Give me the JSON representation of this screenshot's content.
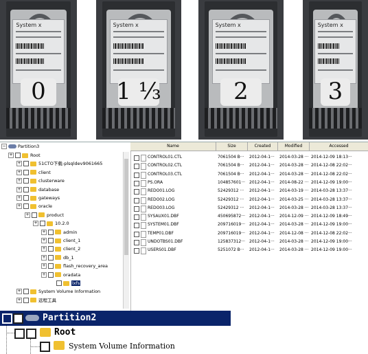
{
  "photos": [
    {
      "handwritten": "0",
      "label_header": "System x"
    },
    {
      "handwritten": "1 ⅓",
      "label_header": "System x"
    },
    {
      "handwritten": "2",
      "label_header": "System x"
    },
    {
      "handwritten": "3",
      "label_header": "System x"
    }
  ],
  "tree": {
    "partition_label": "Partition3",
    "nodes": [
      {
        "label": "Root",
        "level": 0
      },
      {
        "label": "51CTO下载-plsqldev9061665",
        "level": 1
      },
      {
        "label": "client",
        "level": 1
      },
      {
        "label": "clusterware",
        "level": 1
      },
      {
        "label": "database",
        "level": 1
      },
      {
        "label": "gateways",
        "level": 1
      },
      {
        "label": "oracle",
        "level": 1
      },
      {
        "label": "product",
        "level": 2
      },
      {
        "label": "10.2.0",
        "level": 3
      },
      {
        "label": "admin",
        "level": 4
      },
      {
        "label": "client_1",
        "level": 4
      },
      {
        "label": "client_2",
        "level": 4
      },
      {
        "label": "db_1",
        "level": 4
      },
      {
        "label": "flash_recovery_area",
        "level": 4
      },
      {
        "label": "oradata",
        "level": 4
      },
      {
        "label": "lxfs",
        "level": 5,
        "selected": true
      },
      {
        "label": "System Volume Information",
        "level": 1
      },
      {
        "label": "远程工具",
        "level": 1
      }
    ]
  },
  "files": {
    "columns": [
      "Name",
      "Size",
      "Created",
      "Modified",
      "Accessed"
    ],
    "rows": [
      {
        "name": "CONTROL01.CTL",
        "size": "7061504 B···",
        "created": "2012-04-1···",
        "modified": "2014-03-28 ···",
        "accessed": "2014-12-09 18:13···"
      },
      {
        "name": "CONTROL02.CTL",
        "size": "7061504 B···",
        "created": "2012-04-1···",
        "modified": "2014-03-28 ···",
        "accessed": "2014-12-08 22:02···"
      },
      {
        "name": "CONTROL03.CTL",
        "size": "7061504 B···",
        "created": "2012-04-1···",
        "modified": "2014-03-28 ···",
        "accessed": "2014-12-08 22:02···"
      },
      {
        "name": "PS.ORA",
        "size": "104857601···",
        "created": "2012-04-1···",
        "modified": "2014-08-22 ···",
        "accessed": "2014-12-09 19:00···"
      },
      {
        "name": "REDO01.LOG",
        "size": "52429312 ···",
        "created": "2012-04-1···",
        "modified": "2014-03-19 ···",
        "accessed": "2014-03-28 13:37···"
      },
      {
        "name": "REDO02.LOG",
        "size": "52429312 ···",
        "created": "2012-04-1···",
        "modified": "2014-03-25 ···",
        "accessed": "2014-03-28 13:37···"
      },
      {
        "name": "REDO03.LOG",
        "size": "52429312 ···",
        "created": "2012-04-1···",
        "modified": "2014-03-28 ···",
        "accessed": "2014-03-28 13:37···"
      },
      {
        "name": "SYSAUX01.DBF",
        "size": "450695872···",
        "created": "2012-04-1···",
        "modified": "2014-12-09 ···",
        "accessed": "2014-12-09 18:49···"
      },
      {
        "name": "SYSTEM01.DBF",
        "size": "209716019···",
        "created": "2012-04-1···",
        "modified": "2014-03-28 ···",
        "accessed": "2014-12-09 19:00···"
      },
      {
        "name": "TEMP01.DBF",
        "size": "209716019···",
        "created": "2012-04-1···",
        "modified": "2014-12-08 ···",
        "accessed": "2014-12-08 22:02···"
      },
      {
        "name": "UNDOTBS01.DBF",
        "size": "125837312···",
        "created": "2012-04-1···",
        "modified": "2014-03-28 ···",
        "accessed": "2014-12-09 19:00···"
      },
      {
        "name": "USERS01.DBF",
        "size": "5251072 B···",
        "created": "2012-04-1···",
        "modified": "2014-03-28 ···",
        "accessed": "2014-12-09 19:00···"
      }
    ]
  },
  "bottom": {
    "partition_label": "Partition2",
    "root_label": "Root",
    "child_label": "System Volume Information"
  }
}
